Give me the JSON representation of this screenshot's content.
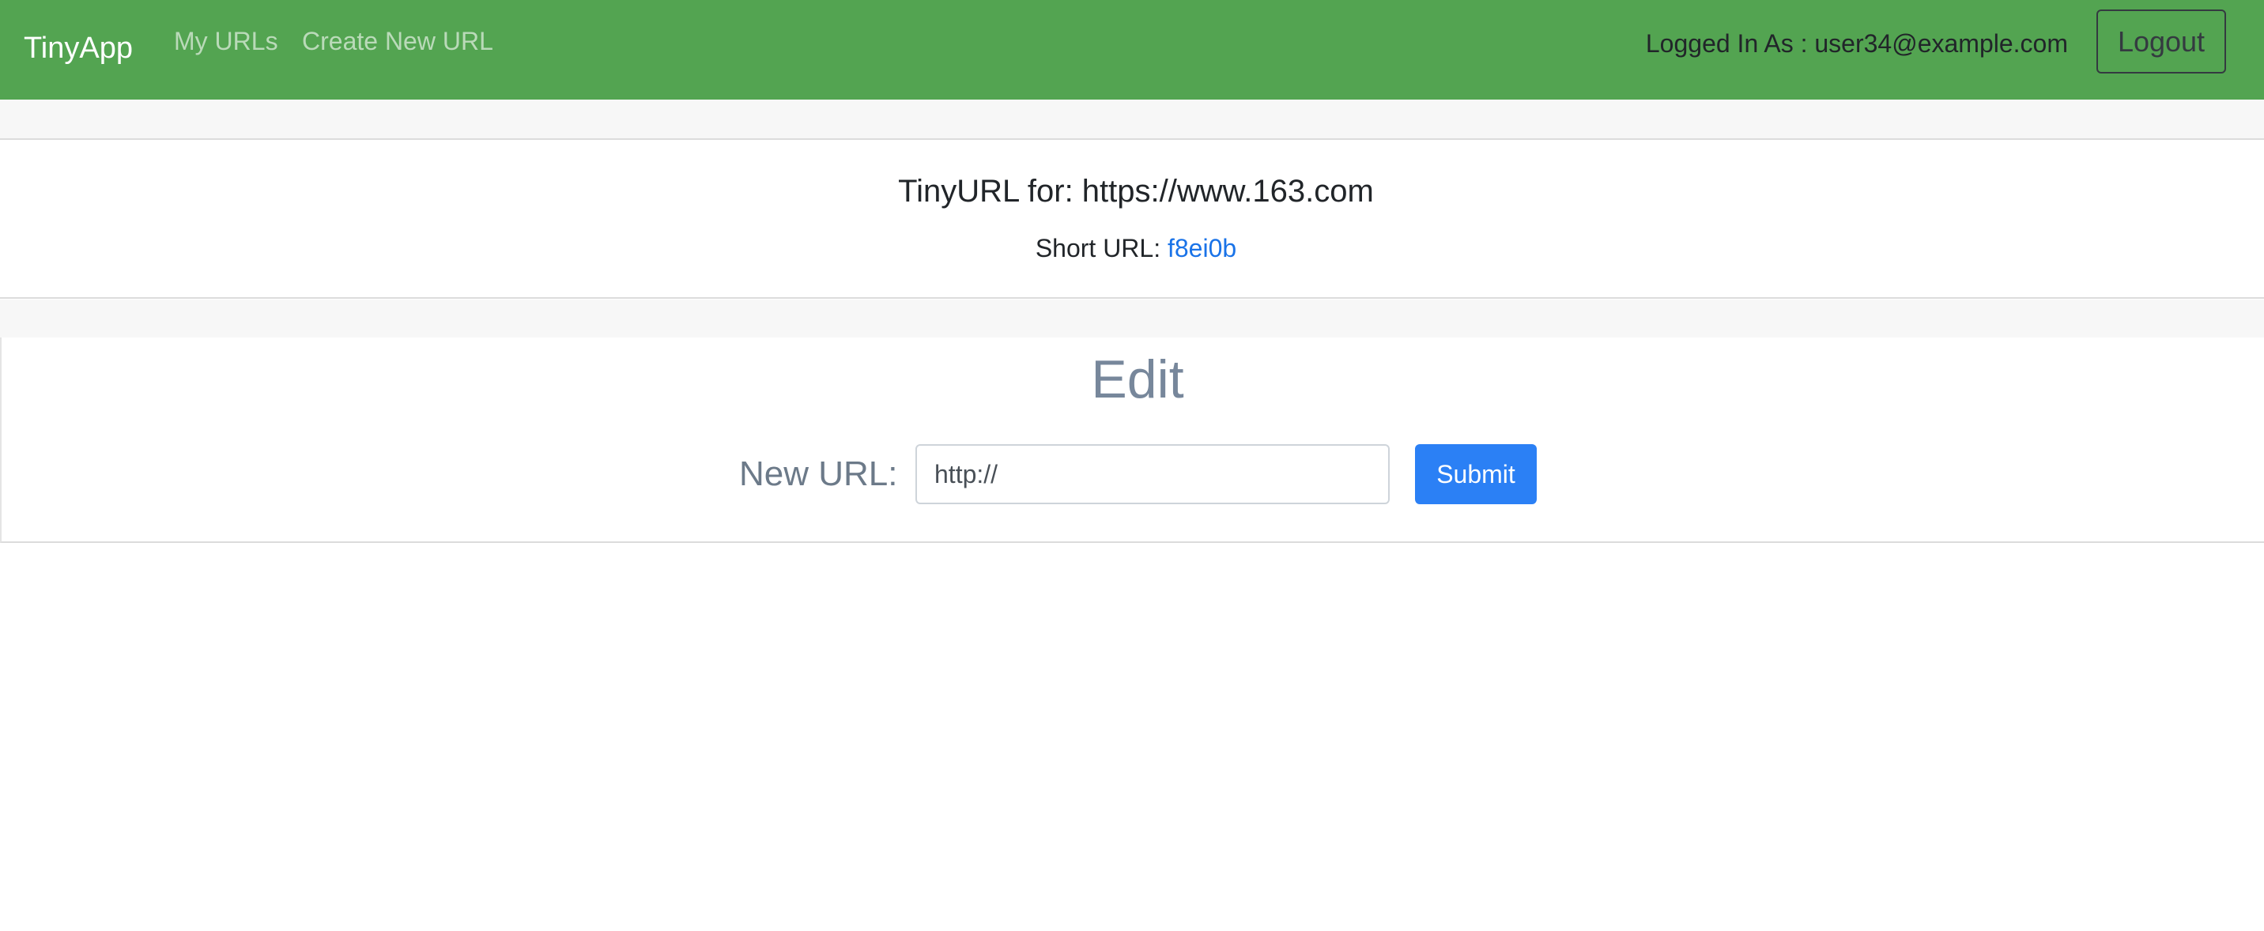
{
  "navbar": {
    "brand": "TinyApp",
    "links": [
      {
        "label": "My URLs"
      },
      {
        "label": "Create New URL"
      }
    ],
    "logged_in_text": "Logged In As : user34@example.com",
    "logout_label": "Logout",
    "background_color": "#53a451"
  },
  "url_info": {
    "title": "TinyURL for: https://www.163.com",
    "short_url_label": "Short URL: ",
    "short_url": "f8ei0b"
  },
  "edit_form": {
    "heading": "Edit",
    "new_url_label": "New URL:",
    "input_placeholder": "http://",
    "input_value": "",
    "submit_label": "Submit",
    "submit_color": "#2b80f5"
  }
}
